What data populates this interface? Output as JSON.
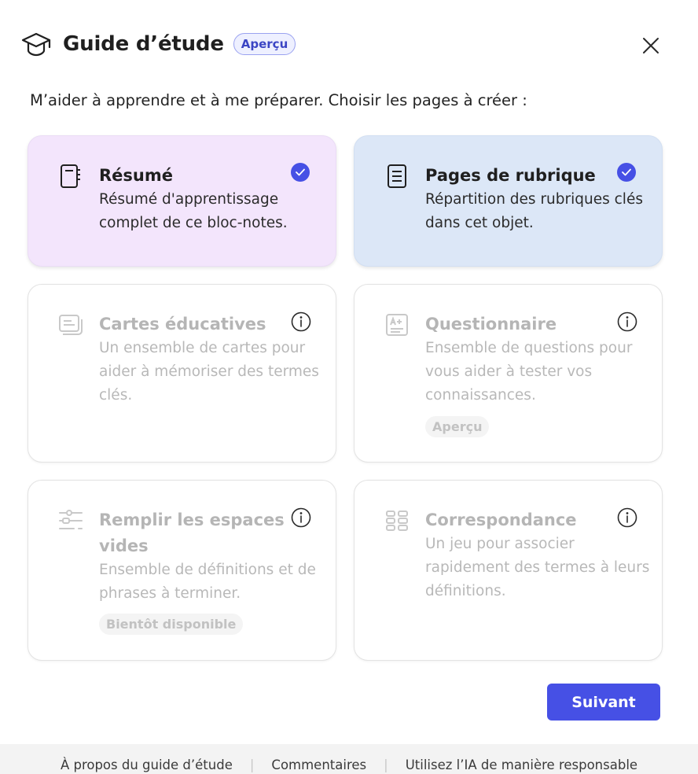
{
  "header": {
    "title": "Guide d’étude",
    "badge": "Aperçu",
    "close_label": "Fermer"
  },
  "subtitle": "M’aider à apprendre et à me préparer. Choisir les pages à créer :",
  "cards": [
    {
      "title": "Résumé",
      "description": "Résumé d'apprentissage complet de ce bloc-notes.",
      "icon": "notebook-icon",
      "state": "selected"
    },
    {
      "title": "Pages de rubrique",
      "description": "Répartition des rubriques clés dans cet objet.",
      "icon": "document-lines-icon",
      "state": "selected"
    },
    {
      "title": "Cartes éducatives",
      "description": "Un ensemble de cartes pour aider à mémoriser des termes clés.",
      "icon": "flashcards-icon",
      "state": "disabled"
    },
    {
      "title": "Questionnaire",
      "description": "Ensemble de questions pour vous aider à tester vos connaissances.",
      "icon": "quiz-icon",
      "state": "disabled",
      "tag": "Aperçu"
    },
    {
      "title": "Remplir les espaces vides",
      "description": "Ensemble de définitions et de phrases à terminer.",
      "icon": "fill-blanks-icon",
      "state": "disabled",
      "tag": "Bientôt disponible"
    },
    {
      "title": "Correspondance",
      "description": "Un jeu pour associer rapidement des termes à leurs définitions.",
      "icon": "matching-icon",
      "state": "disabled"
    }
  ],
  "next_button": "Suivant",
  "footer": {
    "links": [
      "À propos du guide d’étude",
      "Commentaires",
      "Utilisez l’IA de manière responsable"
    ]
  },
  "colors": {
    "accent": "#4650e5",
    "selected_purple": "#f3e5fc",
    "selected_blue": "#dce7f7"
  }
}
